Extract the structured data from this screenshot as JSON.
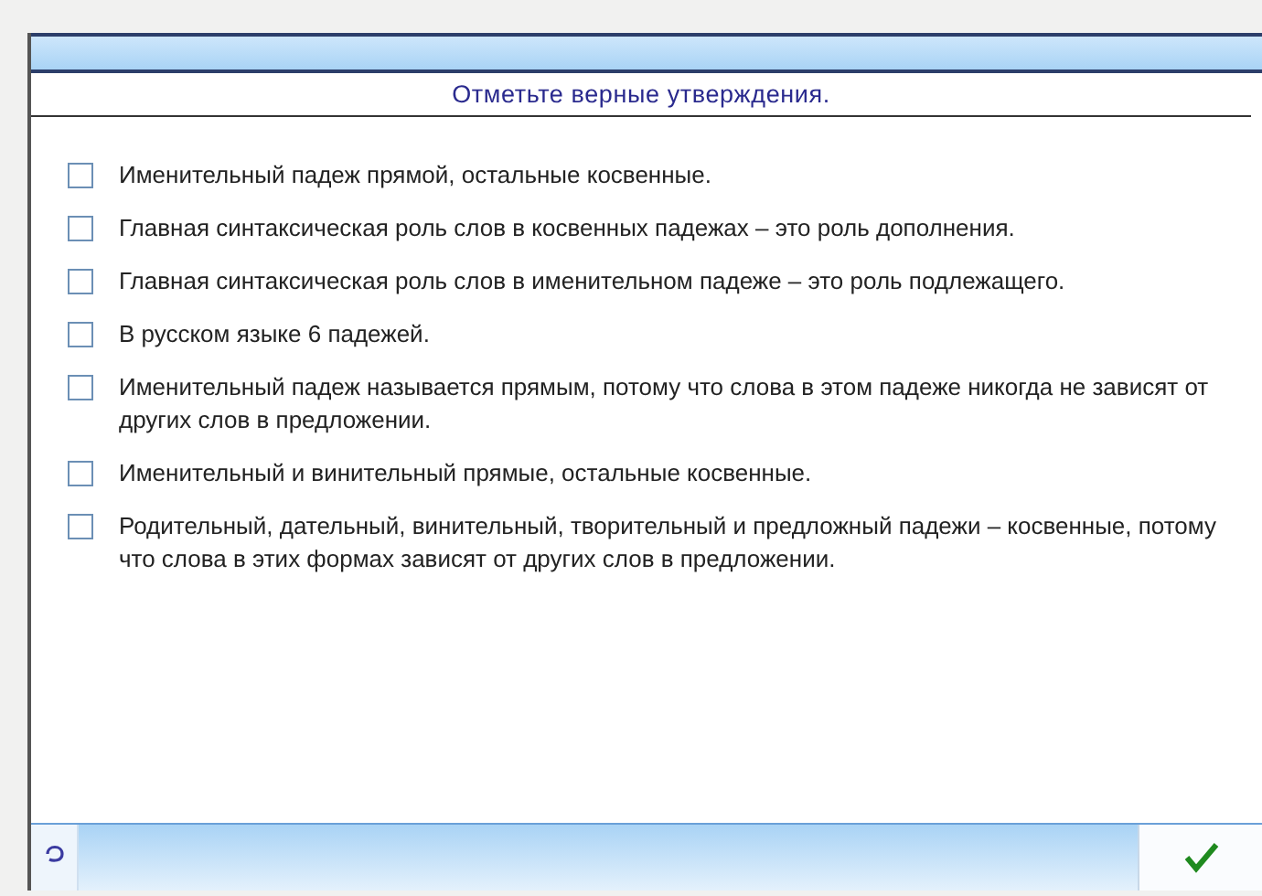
{
  "title": "Отметьте верные утверждения.",
  "options": [
    {
      "text": "Именительный падеж прямой, остальные косвенные.",
      "checked": false
    },
    {
      "text": "Главная синтаксическая роль слов в косвенных падежах – это роль дополнения.",
      "checked": false
    },
    {
      "text": "Главная синтаксическая роль слов в именительном падеже – это роль подлежащего.",
      "checked": false
    },
    {
      "text": "В русском языке 6 падежей.",
      "checked": false
    },
    {
      "text": "Именительный падеж называется прямым, потому что слова в этом падеже никогда не зависят от других слов в предложении.",
      "checked": false
    },
    {
      "text": "Именительный и винительный прямые, остальные косвенные.",
      "checked": false
    },
    {
      "text": "Родительный, дательный, винительный, творительный и предложный падежи – косвенные, потому что слова в этих формах зависят от других слов в предложении.",
      "checked": false
    }
  ]
}
